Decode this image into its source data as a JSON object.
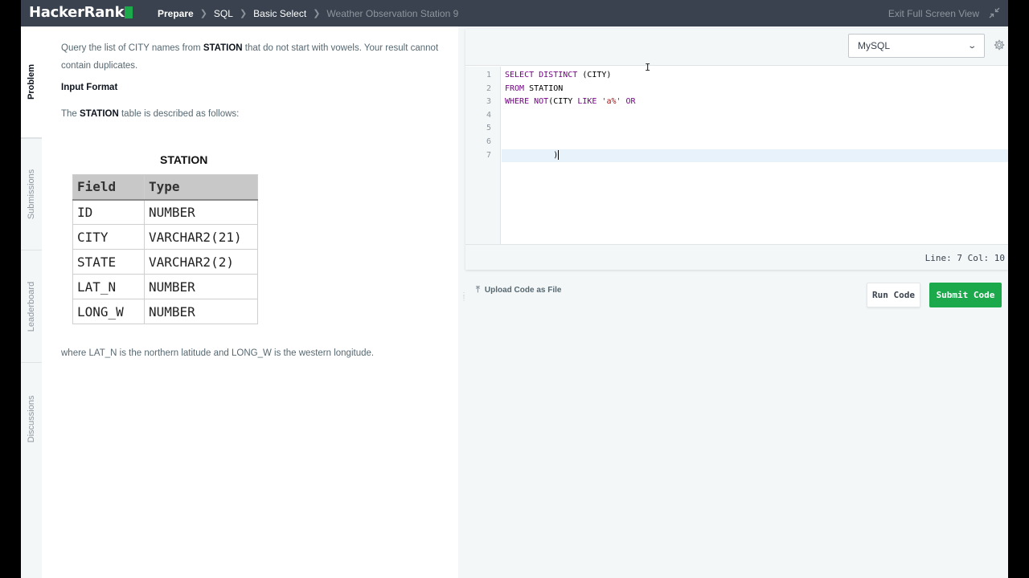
{
  "topbar": {
    "logo": "HackerRank",
    "breadcrumb": [
      "Prepare",
      "SQL",
      "Basic Select",
      "Weather Observation Station 9"
    ],
    "exit_label": "Exit Full Screen View"
  },
  "side_tabs": [
    "Problem",
    "Submissions",
    "Leaderboard",
    "Discussions"
  ],
  "problem": {
    "intro_pre": "Query the list of CITY names from ",
    "intro_bold": "STATION",
    "intro_post": " that do not start with vowels. Your result cannot contain duplicates.",
    "input_format_heading": "Input Format",
    "table_desc_pre": "The ",
    "table_desc_bold": "STATION",
    "table_desc_post": " table is described as follows:",
    "table": {
      "title": "STATION",
      "headers": [
        "Field",
        "Type"
      ],
      "rows": [
        [
          "ID",
          "NUMBER"
        ],
        [
          "CITY",
          "VARCHAR2(21)"
        ],
        [
          "STATE",
          "VARCHAR2(2)"
        ],
        [
          "LAT_N",
          "NUMBER"
        ],
        [
          "LONG_W",
          "NUMBER"
        ]
      ]
    },
    "footer_note": "where LAT_N is the northern latitude and LONG_W is the western longitude."
  },
  "editor": {
    "language": "MySQL",
    "line_numbers": [
      "1",
      "2",
      "3",
      "4",
      "5",
      "6",
      "7"
    ],
    "lines": [
      {
        "kw1": "SELECT DISTINCT",
        "rest": " (CITY)"
      },
      {
        "kw1": "FROM",
        "rest": " STATION"
      },
      {
        "kw1": "WHERE NOT",
        "rest": "(CITY ",
        "kw2": "LIKE",
        "str": " 'a%'",
        "kw3": " OR"
      },
      {},
      {},
      {},
      {
        "rest": "          )"
      }
    ],
    "status": "Line: 7 Col: 10"
  },
  "actions": {
    "upload_label": "Upload Code as File",
    "run_label": "Run Code",
    "submit_label": "Submit Code"
  },
  "colors": {
    "topbar_bg": "#39424e",
    "accent_green": "#1ba94c",
    "keyword": "#770088",
    "string": "#aa1111"
  }
}
